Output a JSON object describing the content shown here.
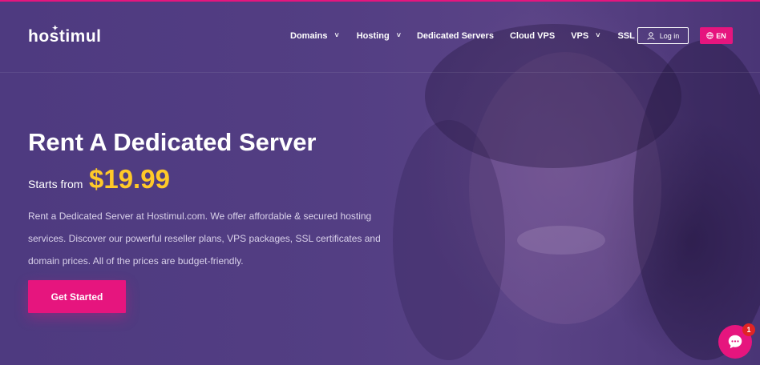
{
  "brand": {
    "logo_text": "hostimul"
  },
  "nav": {
    "items": [
      {
        "label": "Domains",
        "has_dropdown": true
      },
      {
        "label": "Hosting",
        "has_dropdown": true
      },
      {
        "label": "Dedicated Servers",
        "has_dropdown": false
      },
      {
        "label": "Cloud VPS",
        "has_dropdown": false
      },
      {
        "label": "VPS",
        "has_dropdown": true
      },
      {
        "label": "SSL",
        "has_dropdown": false
      }
    ],
    "login_label": "Log in",
    "language_label": "EN"
  },
  "hero": {
    "title": "Rent A Dedicated Server",
    "starts_from": "Starts from",
    "price": "$19.99",
    "description": "Rent a Dedicated Server at Hostimul.com. We offer affordable & secured hosting services. Discover our powerful reseller plans, VPS packages, SSL certificates and domain prices. All of the prices are budget-friendly.",
    "cta_label": "Get Started"
  },
  "chat": {
    "badge_count": "1"
  },
  "colors": {
    "accent": "#e6157e",
    "price": "#ffc928",
    "background": "#4f3a7f",
    "text_muted": "#d9d1ea"
  },
  "icons": {
    "user": "user-icon",
    "globe": "globe-icon",
    "chevron": "chevron-down-icon",
    "chat": "chat-bubble-icon"
  }
}
